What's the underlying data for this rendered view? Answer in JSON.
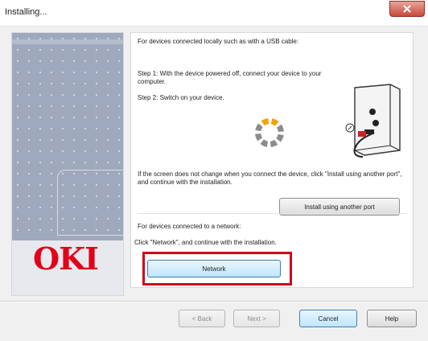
{
  "window": {
    "title": "Installing..."
  },
  "left_panel": {
    "logo_text": "OKI"
  },
  "usb_section": {
    "heading": "For devices connected locally such as with a USB cable:",
    "step1": "Step 1: With the device powered off, connect your device to your computer.",
    "step2": "Step 2: Switch on your device.",
    "note": "If the screen does not change when you connect the device, click \"Install using another port\", and continue with the installation.",
    "install_other_port_label": "Install using another port"
  },
  "network_section": {
    "heading": "For devices connected to a network:",
    "instruction": "Click \"Network\", and continue with the installation.",
    "network_button_label": "Network"
  },
  "footer": {
    "back_label": "< Back",
    "next_label": "Next >",
    "cancel_label": "Cancel",
    "help_label": "Help"
  },
  "colors": {
    "highlight": "#d0021b",
    "brand_red": "#e2001a",
    "spinner_active": "#f0a30a",
    "spinner_idle": "#8c8c8c"
  }
}
